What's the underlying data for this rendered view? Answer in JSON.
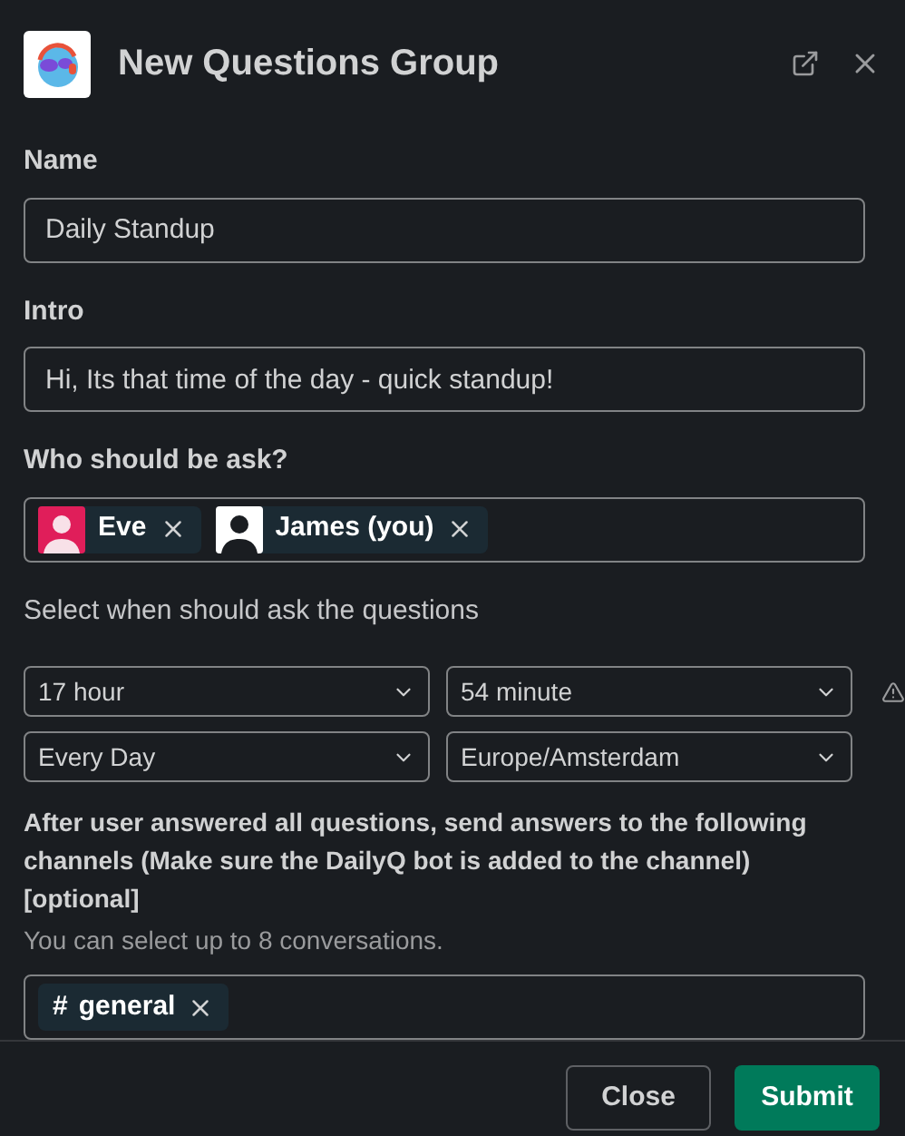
{
  "modal": {
    "title": "New Questions Group"
  },
  "name_field": {
    "label": "Name",
    "value": "Daily Standup"
  },
  "intro_field": {
    "label": "Intro",
    "value": "Hi, Its that time of the day - quick standup!"
  },
  "users_field": {
    "label": "Who should be ask?",
    "users": [
      {
        "name": "Eve",
        "color": "#e01e5a"
      },
      {
        "name": "James (you)",
        "color": "#ffffff"
      }
    ]
  },
  "schedule": {
    "label": "Select when should ask the questions",
    "selects": [
      {
        "value": "17 hour"
      },
      {
        "value": "54 minute"
      },
      {
        "value": "Every Day"
      },
      {
        "value": "Europe/Amsterdam"
      }
    ],
    "warning": true
  },
  "channels_field": {
    "label": "After user answered all questions, send answers to the following channels (Make sure the DailyQ bot is added to the channel) [optional]",
    "hint": "You can select up to 8 conversations.",
    "channels": [
      {
        "prefix": "#",
        "name": "general"
      }
    ]
  },
  "buttons": [
    {
      "kind": "secondary",
      "label": "Close"
    },
    {
      "kind": "primary",
      "label": "Submit"
    }
  ]
}
